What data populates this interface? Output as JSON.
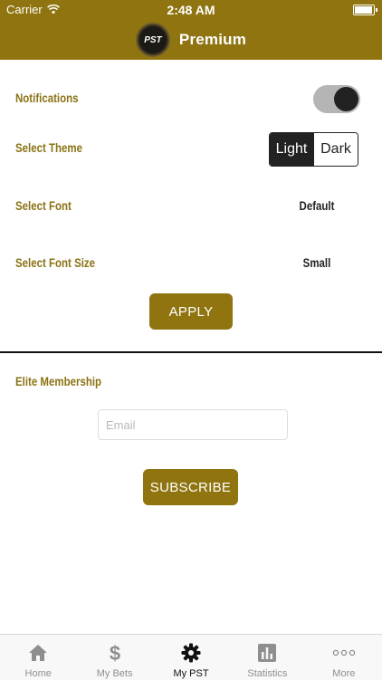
{
  "status_bar": {
    "carrier": "Carrier",
    "time": "2:48 AM",
    "battery_level": 0.95
  },
  "header": {
    "logo_text": "PST",
    "title": "Premium"
  },
  "settings": {
    "notifications_label": "Notifications",
    "notifications_on": true,
    "theme_label": "Select Theme",
    "theme_options": [
      "Light",
      "Dark"
    ],
    "theme_selected": "Light",
    "font_label": "Select Font",
    "font_value": "Default",
    "font_size_label": "Select Font Size",
    "font_size_value": "Small",
    "apply_label": "APPLY"
  },
  "membership": {
    "title": "Elite Membership",
    "email_placeholder": "Email",
    "email_value": "",
    "subscribe_label": "SUBSCRIBE"
  },
  "tabs": [
    {
      "label": "Home",
      "icon": "home-icon"
    },
    {
      "label": "My Bets",
      "icon": "dollar-icon"
    },
    {
      "label": "My PST",
      "icon": "gear-icon",
      "active": true
    },
    {
      "label": "Statistics",
      "icon": "bar-chart-icon"
    },
    {
      "label": "More",
      "icon": "more-icon"
    }
  ],
  "colors": {
    "accent": "#8f7410",
    "label": "#8a7214",
    "dark": "#222222"
  }
}
